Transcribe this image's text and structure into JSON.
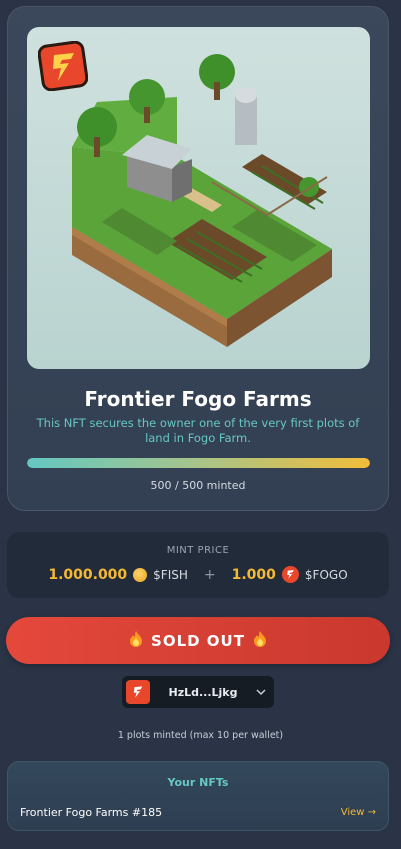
{
  "nft": {
    "title": "Frontier Fogo Farms",
    "description": "This NFT secures the owner one of the very first plots of land in Fogo Farm.",
    "minted_text": "500 / 500 minted",
    "progress_fraction": 1.0
  },
  "price": {
    "label": "MINT PRICE",
    "fish_amount": "1.000.000",
    "fish_token": "$FISH",
    "plus": "+",
    "fogo_amount": "1.000",
    "fogo_token": "$FOGO"
  },
  "sold_out": {
    "label": "SOLD OUT"
  },
  "wallet": {
    "address": "HzLd...Ljkg"
  },
  "plots_text": "1 plots minted (max 10 per wallet)",
  "your_nfts": {
    "title": "Your NFTs",
    "items": [
      {
        "name": "Frontier Fogo Farms #185",
        "action": "View →"
      }
    ]
  },
  "colors": {
    "accent_teal": "#67c7c4",
    "accent_gold": "#f5b935",
    "sold_out_red": "#e4483b",
    "brand_orange": "#e8472b"
  }
}
